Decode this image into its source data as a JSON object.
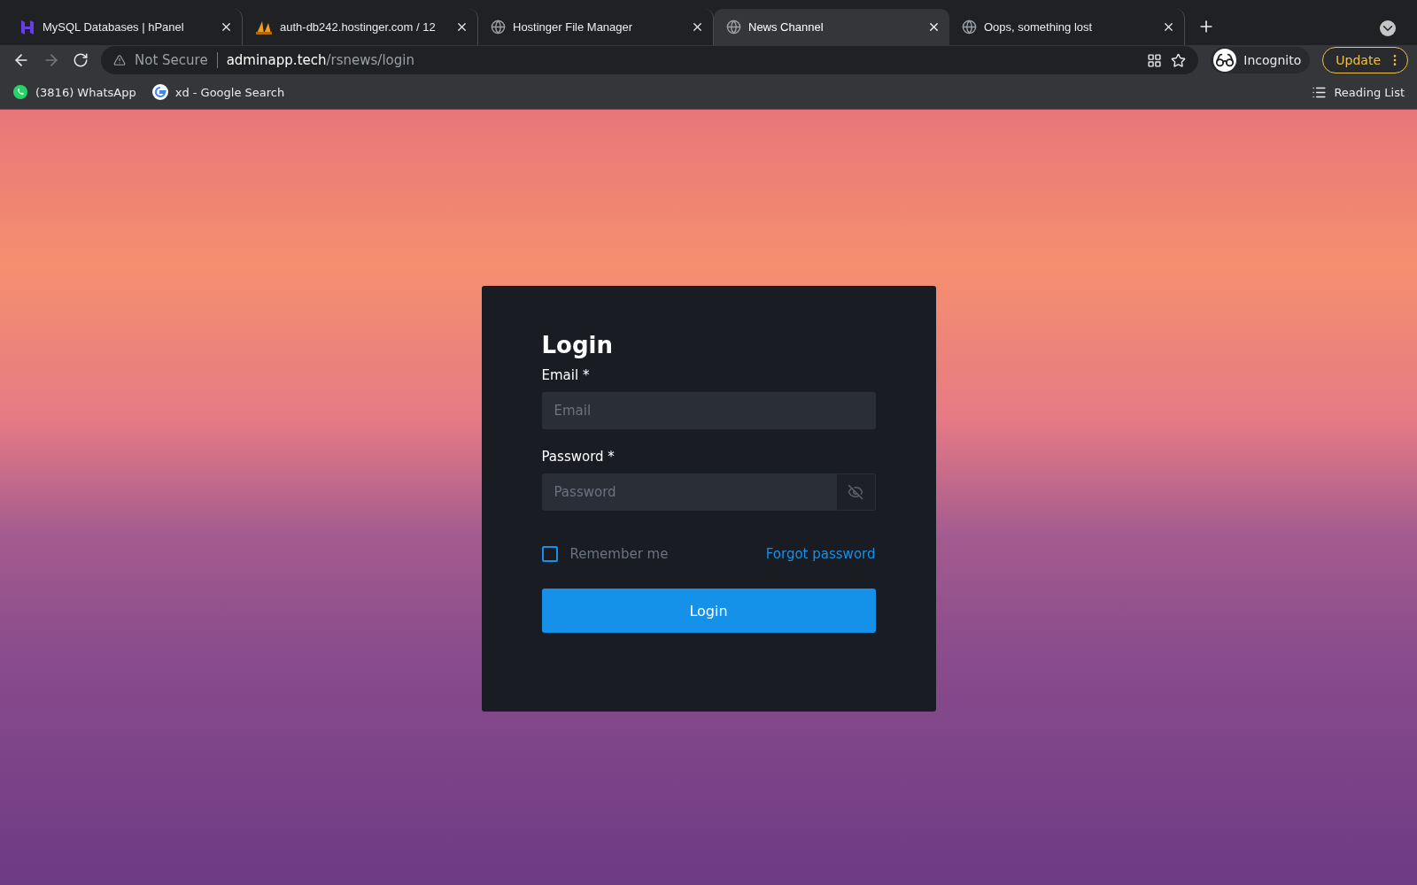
{
  "browser": {
    "tabs": [
      {
        "title": "MySQL Databases | hPanel",
        "kind": "hpanel",
        "selected": false
      },
      {
        "title": "auth-db242.hostinger.com / 12",
        "kind": "pma",
        "selected": false
      },
      {
        "title": "Hostinger File Manager",
        "kind": "globe",
        "selected": false
      },
      {
        "title": "News Channel",
        "kind": "globe",
        "selected": true
      },
      {
        "title": "Oops, something lost",
        "kind": "globe",
        "selected": false
      }
    ],
    "security": "Not Secure",
    "url_host": "adminapp.tech",
    "url_path": "/rsnews/login",
    "profile": "Incognito",
    "update": "Update",
    "bookmarks": [
      {
        "title": "(3816) WhatsApp",
        "kind": "whatsapp"
      },
      {
        "title": "xd - Google Search",
        "kind": "google"
      }
    ],
    "reading_list": "Reading List"
  },
  "login": {
    "title": "Login",
    "email_label": "Email *",
    "email_placeholder": "Email",
    "password_label": "Password *",
    "password_placeholder": "Password",
    "remember": {
      "label": "Remember me",
      "checked": false
    },
    "forgot": "Forgot password",
    "submit": "Login"
  }
}
